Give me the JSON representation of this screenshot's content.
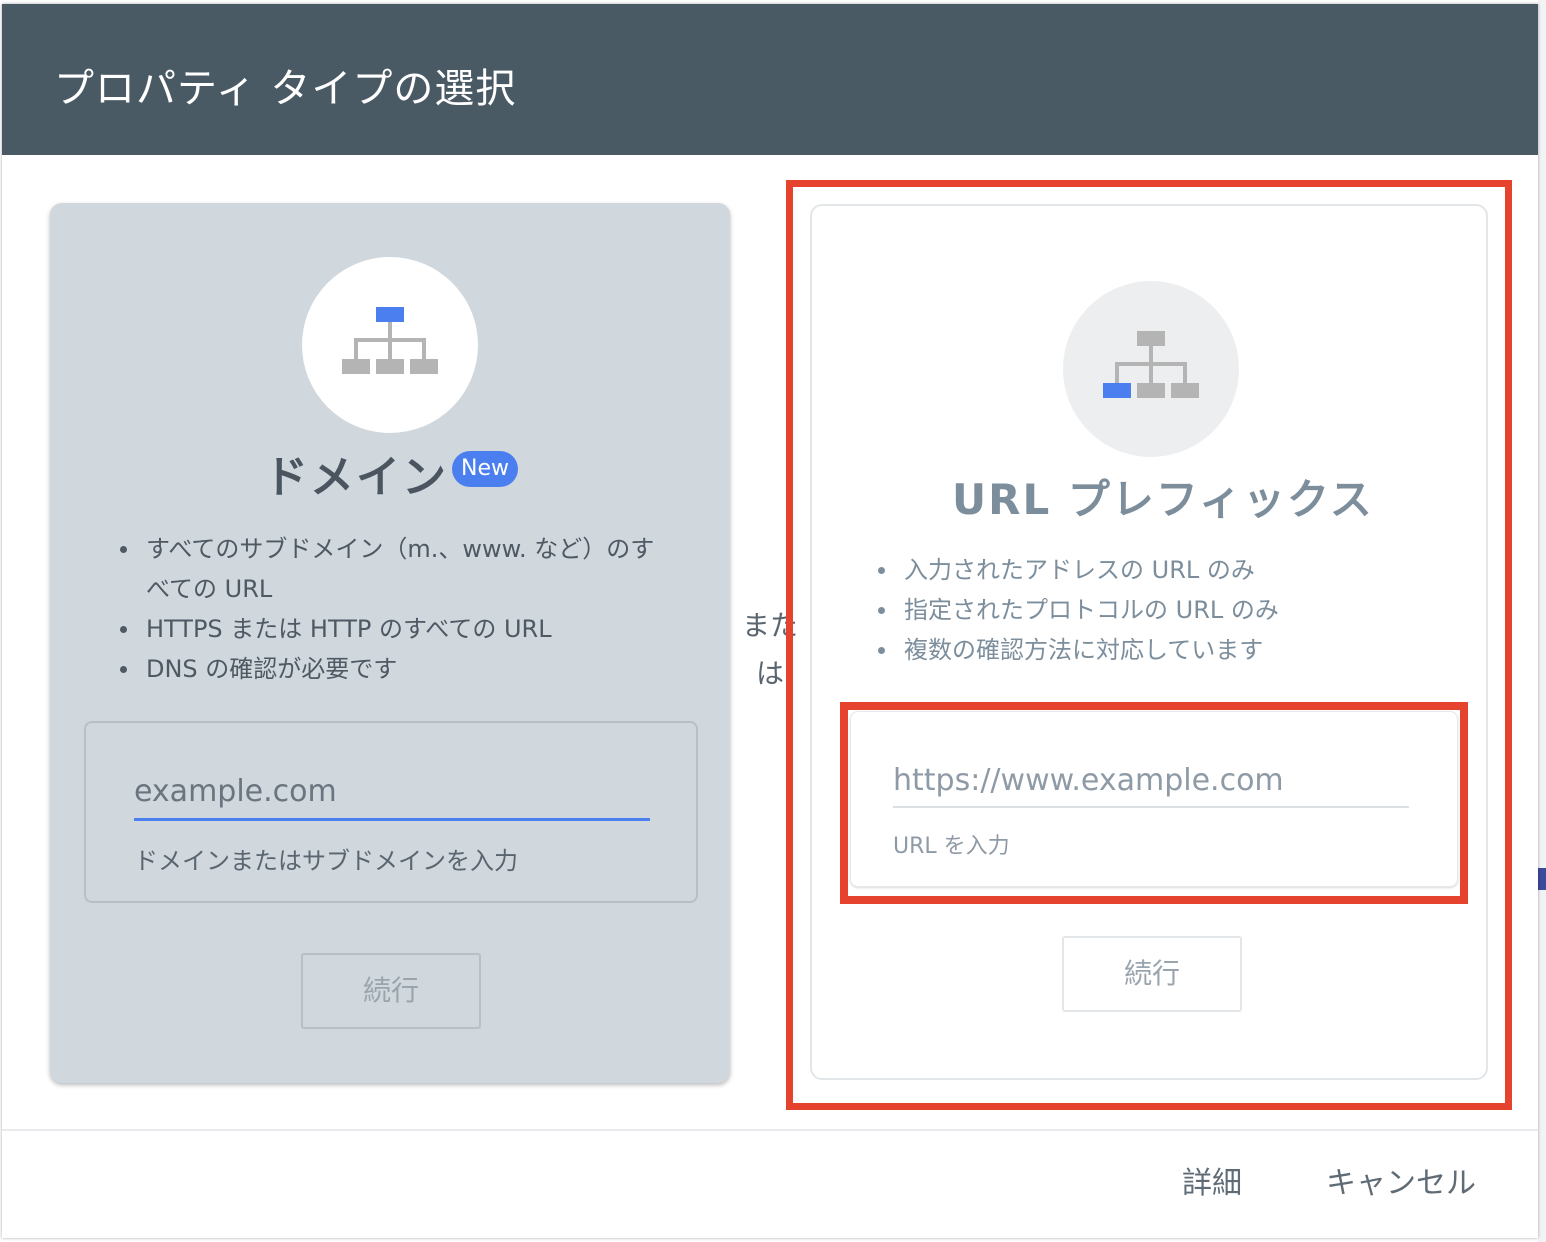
{
  "dialog": {
    "title": "プロパティ タイプの選択"
  },
  "domain_card": {
    "icon": "sitemap-icon",
    "title": "ドメイン",
    "badge": "New",
    "bullets": [
      "すべてのサブドメイン（m.、www. など）のすべての URL",
      "HTTPS または HTTP のすべての URL",
      "DNS の確認が必要です"
    ],
    "input_placeholder": "example.com",
    "helper": "ドメインまたはサブドメインを入力",
    "continue_label": "続行"
  },
  "separator": {
    "or_label": "または"
  },
  "url_card": {
    "icon": "sitemap-icon",
    "title": "URL プレフィックス",
    "bullets": [
      "入力されたアドレスの URL のみ",
      "指定されたプロトコルの URL のみ",
      "複数の確認方法に対応しています"
    ],
    "input_placeholder": "https://www.example.com",
    "helper": "URL を入力",
    "continue_label": "続行"
  },
  "footer": {
    "detail_label": "詳細",
    "cancel_label": "キャンセル"
  },
  "colors": {
    "header_bg": "#4a5a65",
    "accent_blue": "#4b7ff0",
    "annotation_red": "#e5432d"
  }
}
